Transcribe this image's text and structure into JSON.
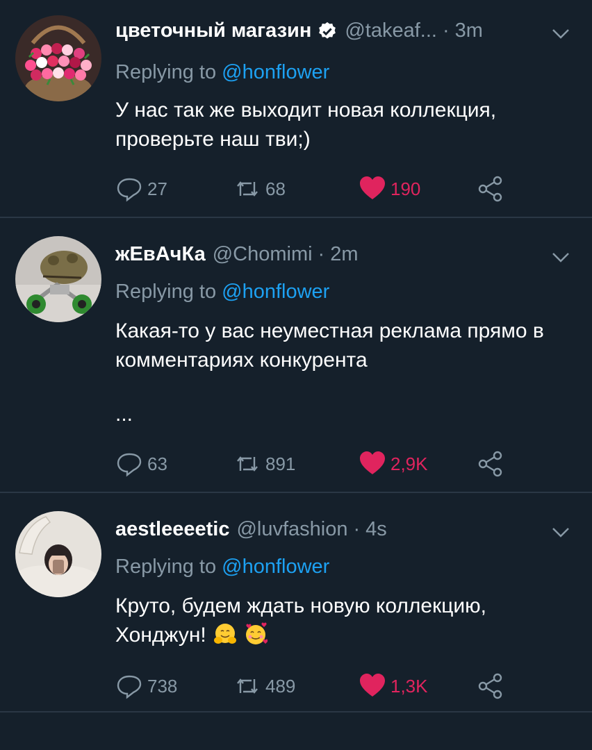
{
  "tweets": [
    {
      "name": "цветочный магазин",
      "handle": "@takeaf...",
      "time": "3m",
      "verified": true,
      "replying_label": "Replying to ",
      "replying_to": "@honflower",
      "text": "У нас так же выходит новая коллекция, проверьте наш тви;)",
      "extra": "",
      "replies": "27",
      "retweets": "68",
      "likes": "190"
    },
    {
      "name": "жЕвАчКа",
      "handle": "@Chomimi",
      "time": "2m",
      "verified": false,
      "replying_label": "Replying to ",
      "replying_to": "@honflower",
      "text": "Какая-то у вас неуместная реклама прямо в комментариях конкурента",
      "extra": "...",
      "replies": "63",
      "retweets": "891",
      "likes": "2,9K"
    },
    {
      "name": "aestleeeetic",
      "handle": "@luvfashion",
      "time": "4s",
      "verified": false,
      "replying_label": "Replying to ",
      "replying_to": "@honflower",
      "text": "Круто, будем ждать новую коллекцию, Хонджун!",
      "extra": "",
      "replies": "738",
      "retweets": "489",
      "likes": "1,3K"
    }
  ],
  "colors": {
    "background": "#15202b",
    "secondary_text": "#8899a6",
    "mention": "#1da1f2",
    "like": "#e0245e",
    "divider": "#2a3745"
  },
  "icons": [
    "verified-icon",
    "chevron-down-icon",
    "reply-icon",
    "retweet-icon",
    "heart-icon",
    "share-icon",
    "hugging-face-emoji",
    "smiling-hearts-emoji"
  ]
}
